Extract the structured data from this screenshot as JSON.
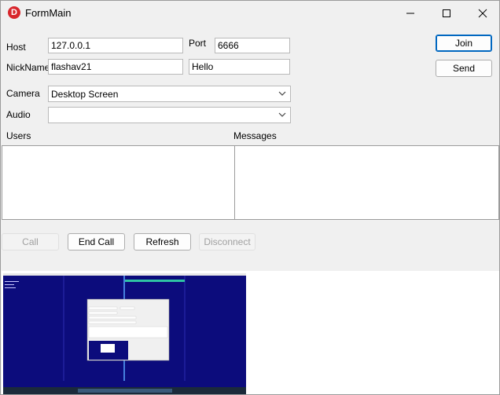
{
  "window": {
    "title": "FormMain"
  },
  "form": {
    "host_label": "Host",
    "host_value": "127.0.0.1",
    "port_label": "Port",
    "port_value": "6666",
    "nickname_label": "NickName",
    "nickname_value": "flashav21",
    "message_value": "Hello",
    "camera_label": "Camera",
    "camera_value": "Desktop Screen",
    "audio_label": "Audio",
    "audio_value": "",
    "users_label": "Users",
    "messages_label": "Messages"
  },
  "buttons": {
    "join": "Join",
    "send": "Send",
    "call": "Call",
    "end_call": "End Call",
    "refresh": "Refresh",
    "disconnect": "Disconnect"
  },
  "colors": {
    "app_icon": "#d8262c",
    "screen_bg": "#0c0c7c",
    "focus_border": "#0067c0"
  },
  "icons": {
    "app": "app-logo-icon",
    "minimize": "minimize-icon",
    "maximize": "maximize-icon",
    "close": "close-icon",
    "dropdown": "chevron-down-icon"
  }
}
